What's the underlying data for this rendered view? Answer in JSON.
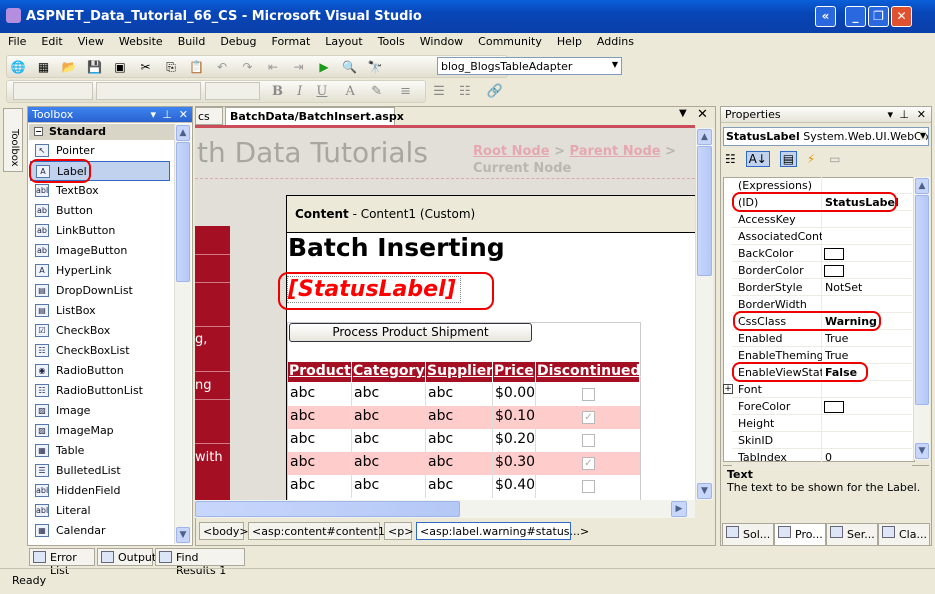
{
  "window": {
    "title": "ASPNET_Data_Tutorial_66_CS - Microsoft Visual Studio",
    "controls": [
      "minimize",
      "restore",
      "close"
    ]
  },
  "menu": [
    "File",
    "Edit",
    "View",
    "Website",
    "Build",
    "Debug",
    "Format",
    "Layout",
    "Tools",
    "Window",
    "Community",
    "Help",
    "Addins"
  ],
  "toolbar": {
    "find_combo_value": "blog_BlogsTableAdapter",
    "format_buttons": [
      "B",
      "I",
      "U"
    ]
  },
  "toolbox": {
    "title": "Toolbox",
    "side_tab": "Toolbox",
    "group": "Standard",
    "items": [
      "Pointer",
      "Label",
      "TextBox",
      "Button",
      "LinkButton",
      "ImageButton",
      "HyperLink",
      "DropDownList",
      "ListBox",
      "CheckBox",
      "CheckBoxList",
      "RadioButton",
      "RadioButtonList",
      "Image",
      "ImageMap",
      "Table",
      "BulletedList",
      "HiddenField",
      "Literal",
      "Calendar"
    ],
    "selected": "Label"
  },
  "editor": {
    "tabs": [
      "cs",
      "BatchData/BatchInsert.aspx"
    ],
    "active_tab": "BatchData/BatchInsert.aspx",
    "site_title": "th Data Tutorials",
    "breadcrumb": {
      "root": "Root Node",
      "sep": ">",
      "parent": "Parent Node",
      "current": "Current Node"
    },
    "menu_fragments": [
      "g,",
      "ng",
      "with"
    ],
    "content_header_bold": "Content",
    "content_header_rest": " - Content1 (Custom)",
    "heading": "Batch Inserting",
    "status_label": "[StatusLabel]",
    "button_label": "Process Product Shipment",
    "grid": {
      "columns": [
        "Product",
        "Category",
        "Supplier",
        "Price",
        "Discontinued"
      ],
      "rows": [
        [
          "abc",
          "abc",
          "abc",
          "$0.00",
          false
        ],
        [
          "abc",
          "abc",
          "abc",
          "$0.10",
          true
        ],
        [
          "abc",
          "abc",
          "abc",
          "$0.20",
          false
        ],
        [
          "abc",
          "abc",
          "abc",
          "$0.30",
          true
        ],
        [
          "abc",
          "abc",
          "abc",
          "$0.40",
          false
        ]
      ]
    },
    "tag_path": [
      "<body>",
      "<asp:content#content1>",
      "<p>",
      "<asp:label.warning#status...>"
    ]
  },
  "properties": {
    "title": "Properties",
    "object_name": "StatusLabel",
    "object_type": "System.Web.UI.WebCon",
    "rows": [
      {
        "name": "(Expressions)",
        "value": ""
      },
      {
        "name": "(ID)",
        "value": "StatusLabel",
        "bold": true
      },
      {
        "name": "AccessKey",
        "value": ""
      },
      {
        "name": "AssociatedContro",
        "value": ""
      },
      {
        "name": "BackColor",
        "value": "",
        "swatch": true
      },
      {
        "name": "BorderColor",
        "value": "",
        "swatch": true
      },
      {
        "name": "BorderStyle",
        "value": "NotSet"
      },
      {
        "name": "BorderWidth",
        "value": ""
      },
      {
        "name": "CssClass",
        "value": "Warning",
        "bold": true
      },
      {
        "name": "Enabled",
        "value": "True"
      },
      {
        "name": "EnableTheming",
        "value": "True"
      },
      {
        "name": "EnableViewState",
        "value": "False",
        "bold": true
      },
      {
        "name": "Font",
        "value": "",
        "expandable": true
      },
      {
        "name": "ForeColor",
        "value": "",
        "swatch": true
      },
      {
        "name": "Height",
        "value": ""
      },
      {
        "name": "SkinID",
        "value": ""
      },
      {
        "name": "TabIndex",
        "value": "0"
      }
    ],
    "desc_title": "Text",
    "desc_text": "The text to be shown for the Label.",
    "bottom_tabs": [
      "Sol...",
      "Pro...",
      "Ser...",
      "Cla..."
    ]
  },
  "bottom_tabs": [
    "Error List",
    "Output",
    "Find Results 1"
  ],
  "status": "Ready",
  "colors": {
    "accent_red": "#a50f23",
    "alt_row": "#ffcccc",
    "highlight": "#ff0000",
    "titlebar": "#0a4fc4"
  }
}
